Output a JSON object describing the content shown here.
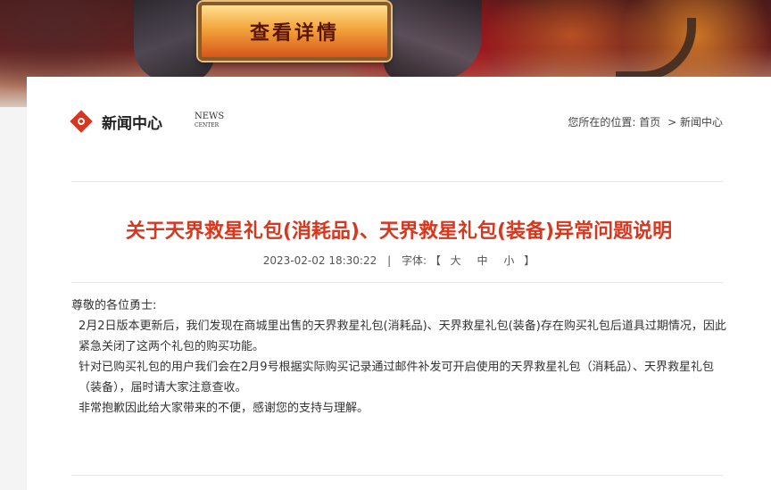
{
  "banner": {
    "detail_button_label": "查看详情"
  },
  "header": {
    "section_title": "新闻中心",
    "section_en_line1": "NEWS",
    "section_en_line2": "CENTER",
    "breadcrumb_prefix": "您所在的位置:",
    "breadcrumb_home": "首页",
    "breadcrumb_sep": ">",
    "breadcrumb_current": "新闻中心"
  },
  "article": {
    "title": "关于天界救星礼包(消耗品)、天界救星礼包(装备)异常问题说明",
    "datetime": "2023-02-02 18:30:22",
    "meta_sep": "|",
    "font_label": "字体:",
    "bracket_open": "【",
    "font_large": "大",
    "font_medium": "中",
    "font_small": "小",
    "bracket_close": "】",
    "paragraphs": [
      "尊敬的各位勇士:",
      "2月2日版本更新后，我们发现在商城里出售的天界救星礼包(消耗品)、天界救星礼包(装备)存在购买礼包后道具过期情况，因此紧急关闭了这两个礼包的购买功能。",
      "针对已购买礼包的用户我们会在2月9号根据实际购买记录通过邮件补发可开启使用的天界救星礼包（消耗品）、天界救星礼包（装备），届时请大家注意查收。",
      "非常抱歉因此给大家带来的不便，感谢您的支持与理解。"
    ]
  },
  "colors": {
    "accent": "#d9361e"
  }
}
